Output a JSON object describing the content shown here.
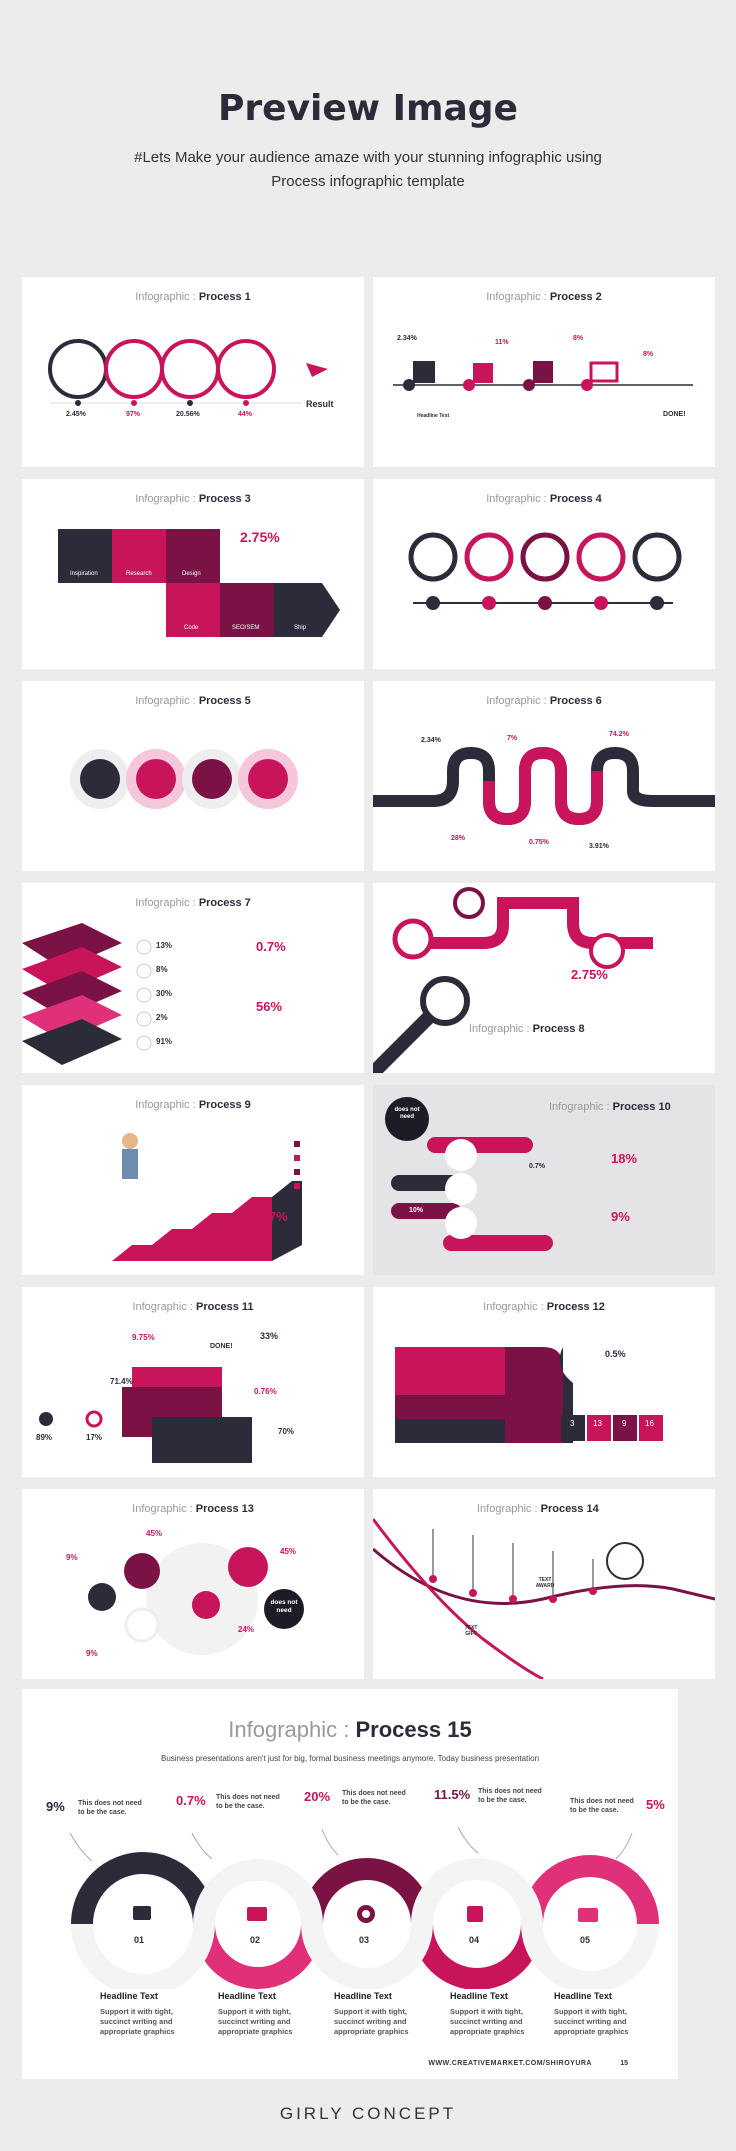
{
  "header": {
    "title": "Preview Image",
    "subtitle": "#Lets Make your audience amaze with your stunning infographic using Process infographic template"
  },
  "slides": [
    {
      "prefix": "Infographic :",
      "name": "Process 1"
    },
    {
      "prefix": "Infographic :",
      "name": "Process 2"
    },
    {
      "prefix": "Infographic :",
      "name": "Process 3"
    },
    {
      "prefix": "Infographic :",
      "name": "Process 4"
    },
    {
      "prefix": "Infographic :",
      "name": "Process 5"
    },
    {
      "prefix": "Infographic :",
      "name": "Process 6"
    },
    {
      "prefix": "Infographic :",
      "name": "Process 7"
    },
    {
      "prefix": "Infographic :",
      "name": "Process 8"
    },
    {
      "prefix": "Infographic :",
      "name": "Process 9"
    },
    {
      "prefix": "Infographic :",
      "name": "Process 10"
    },
    {
      "prefix": "Infographic :",
      "name": "Process 11"
    },
    {
      "prefix": "Infographic :",
      "name": "Process 12"
    },
    {
      "prefix": "Infographic :",
      "name": "Process 13"
    },
    {
      "prefix": "Infographic :",
      "name": "Process 14"
    }
  ],
  "slide_details": {
    "p1": {
      "values": [
        "2.45%",
        "97%",
        "20.56%",
        "44%"
      ],
      "result": "Result"
    },
    "p2": {
      "values": [
        "2.34%",
        "11%",
        "8%",
        "8%"
      ],
      "headline": "Headline Text",
      "done": "DONE!"
    },
    "p3": {
      "value": "2.75%",
      "steps": [
        "Inspiration",
        "Research",
        "Design",
        "Code",
        "SEO/SEM",
        "Ship"
      ]
    },
    "p6": {
      "values": [
        "2.34%",
        "7%",
        "74.2%",
        "28%",
        "0.75%",
        "3.91%"
      ]
    },
    "p7": {
      "values": [
        "13%",
        "8%",
        "30%",
        "2%",
        "91%"
      ],
      "big": [
        "0.7%",
        "56%"
      ]
    },
    "p8": {
      "value": "2.75%"
    },
    "p9": {
      "value": "0.7%"
    },
    "p10": {
      "badge": "does not need",
      "values": [
        "0.7%",
        "10%",
        "18%",
        "9%"
      ]
    },
    "p11": {
      "values": [
        "9.75%",
        "33%",
        "71.4%",
        "0.76%",
        "70%",
        "89%",
        "17%"
      ],
      "done": "DONE!"
    },
    "p12": {
      "value": "0.5%",
      "boxes": [
        "3",
        "13",
        "9",
        "16"
      ]
    },
    "p13": {
      "values": [
        "45%",
        "9%",
        "45%",
        "24%",
        "9%"
      ],
      "badge": "does not need"
    },
    "p14": {
      "labels": [
        "TEXT AWARD",
        "TEXT GIFT"
      ]
    }
  },
  "process15": {
    "prefix": "Infographic :",
    "name": "Process 15",
    "subtitle": "Business presentations aren't just for big, formal business meetings anymore. Today business presentation",
    "stats": [
      {
        "value": "9%",
        "note": "This does not need to be the case."
      },
      {
        "value": "0.7%",
        "note": "This does not need to be the case."
      },
      {
        "value": "20%",
        "note": "This does not need to be the case."
      },
      {
        "value": "11.5%",
        "note": "This does not need to be the case."
      },
      {
        "value": "5%",
        "note": "This does not need to be the case."
      }
    ],
    "steps": [
      {
        "num": "01",
        "headline": "Headline Text",
        "desc": "Support it with tight, succinct writing and appropriate graphics"
      },
      {
        "num": "02",
        "headline": "Headline Text",
        "desc": "Support it with tight, succinct writing and appropriate graphics"
      },
      {
        "num": "03",
        "headline": "Headline Text",
        "desc": "Support it with tight, succinct writing and appropriate graphics"
      },
      {
        "num": "04",
        "headline": "Headline Text",
        "desc": "Support it with tight, succinct writing and appropriate graphics"
      },
      {
        "num": "05",
        "headline": "Headline Text",
        "desc": "Support it with tight, succinct writing and appropriate graphics"
      }
    ],
    "site": "WWW.CREATIVEMARKET.COM/SHIROYURA",
    "page": "15"
  },
  "footer": "GIRLY CONCEPT",
  "colors": {
    "pink": "#c8145a",
    "magenta": "#e0307a",
    "dark": "#2b2b3a",
    "plum": "#7a1245"
  }
}
